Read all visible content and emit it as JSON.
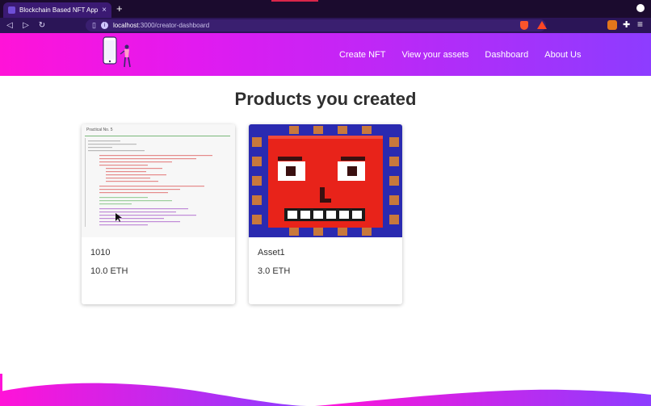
{
  "browser": {
    "tab_title": "Blockchain Based NFT Applicat",
    "tab_close": "×",
    "new_tab": "+",
    "url_host": "localhost",
    "url_path": ":3000/creator-dashboard"
  },
  "nav": {
    "items": [
      "Create NFT",
      "View your assets",
      "Dashboard",
      "About Us"
    ]
  },
  "page": {
    "title": "Products you created"
  },
  "products": [
    {
      "name": "1010",
      "price": "10.0 ETH"
    },
    {
      "name": "Asset1",
      "price": "3.0 ETH"
    }
  ],
  "document_thumb": {
    "heading": "Practical No. 5"
  },
  "colors": {
    "header_start": "#ff13d8",
    "header_end": "#8d3cff",
    "asset_face": "#e8231a",
    "asset_border": "#2a2ab0"
  }
}
